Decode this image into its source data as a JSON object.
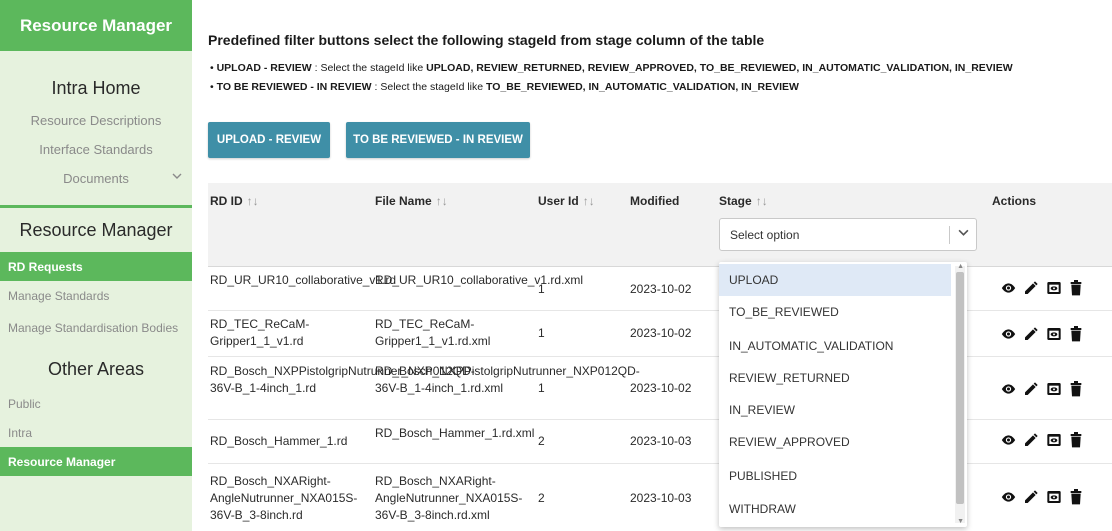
{
  "sidebar": {
    "brand": "Resource Manager",
    "intra_home": "Intra Home",
    "intra_items": [
      "Resource Descriptions",
      "Interface Standards"
    ],
    "documents": "Documents",
    "rm_heading": "Resource Manager",
    "rm_items": [
      {
        "label": "RD Requests",
        "active": true
      },
      {
        "label": "Manage Standards",
        "active": false
      },
      {
        "label": "Manage Standardisation Bodies",
        "active": false
      }
    ],
    "other_heading": "Other Areas",
    "other_items": [
      {
        "label": "Public",
        "active": false
      },
      {
        "label": "Intra",
        "active": false
      },
      {
        "label": "Resource Manager",
        "active": true
      }
    ]
  },
  "main": {
    "title": "Predefined filter buttons select the following stageId from stage column of the table",
    "bullets": [
      {
        "key": "UPLOAD - REVIEW",
        "text": "Select the stageId like",
        "values": "UPLOAD, REVIEW_RETURNED, REVIEW_APPROVED, TO_BE_REVIEWED, IN_AUTOMATIC_VALIDATION, IN_REVIEW"
      },
      {
        "key": "TO BE REVIEWED - IN REVIEW",
        "text": "Select the stageId like",
        "values": "TO_BE_REVIEWED, IN_AUTOMATIC_VALIDATION, IN_REVIEW"
      }
    ],
    "buttons": [
      "UPLOAD - REVIEW",
      "TO BE REVIEWED - IN REVIEW"
    ]
  },
  "table": {
    "headers": {
      "rdid": "RD ID",
      "file": "File Name",
      "user": "User Id",
      "modified": "Modified",
      "stage": "Stage",
      "actions": "Actions"
    },
    "sort_glyph": "↑↓",
    "stage_placeholder": "Select option",
    "rows": [
      {
        "rdid": "RD_UR_UR10_collaborative_v1.rd",
        "file": "RD_UR_UR10_collaborative_v1.rd.xml",
        "user": "1",
        "modified": "2023-10-02"
      },
      {
        "rdid": "RD_TEC_ReCaM-Gripper1_1_v1.rd",
        "file": "RD_TEC_ReCaM-Gripper1_1_v1.rd.xml",
        "user": "1",
        "modified": "2023-10-02"
      },
      {
        "rdid": "RD_Bosch_NXPPistolgripNutrunner_NXP012QD-36V-B_1-4inch_1.rd",
        "file": "RD_Bosch_NXPPistolgripNutrunner_NXP012QD-36V-B_1-4inch_1.rd.xml",
        "user": "1",
        "modified": "2023-10-02"
      },
      {
        "rdid": "RD_Bosch_Hammer_1.rd",
        "file": "RD_Bosch_Hammer_1.rd.xml",
        "user": "2",
        "modified": "2023-10-03"
      },
      {
        "rdid": "RD_Bosch_NXARight-AngleNutrunner_NXA015S-36V-B_3-8inch.rd",
        "file": "RD_Bosch_NXARight-AngleNutrunner_NXA015S-36V-B_3-8inch.rd.xml",
        "user": "2",
        "modified": "2023-10-03"
      }
    ],
    "action_icons": [
      "eye-icon",
      "pencil-icon",
      "preview-icon",
      "trash-icon"
    ]
  },
  "dropdown": {
    "options": [
      "UPLOAD",
      "TO_BE_REVIEWED",
      "IN_AUTOMATIC_VALIDATION",
      "REVIEW_RETURNED",
      "IN_REVIEW",
      "REVIEW_APPROVED",
      "PUBLISHED",
      "WITHDRAW"
    ],
    "highlighted": "UPLOAD"
  },
  "colors": {
    "accent": "#5cb85c",
    "button": "#3f8fa7",
    "sidebar_bg": "#e6f2de"
  }
}
